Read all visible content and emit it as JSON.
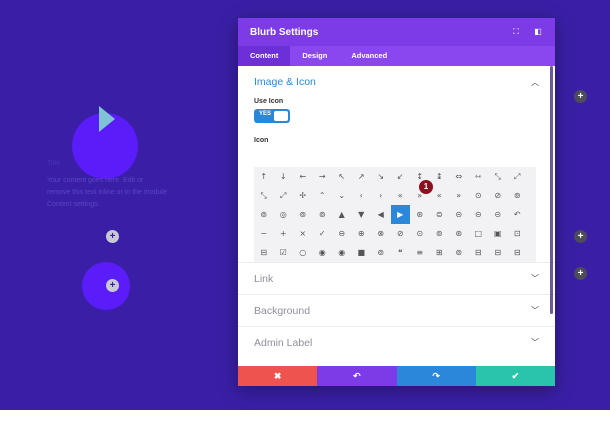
{
  "page": {
    "blurb_title": "Title",
    "blurb_text": "Your content goes here. Edit or remove this text inline or in the module Content settings."
  },
  "modal": {
    "title": "Blurb Settings",
    "header_icons": [
      "fullscreen-icon",
      "sidebar-toggle-icon"
    ],
    "tabs": [
      {
        "label": "Content",
        "active": true
      },
      {
        "label": "Design",
        "active": false
      },
      {
        "label": "Advanced",
        "active": false
      }
    ],
    "section_image_icon": {
      "title": "Image & Icon",
      "use_icon_label": "Use Icon",
      "toggle_value": "YES",
      "icon_label": "Icon",
      "icon_rows": [
        [
          "↑",
          "↓",
          "←",
          "→",
          "↖",
          "↗",
          "↘",
          "↙",
          "↕",
          "↨",
          "⇔",
          "⇿",
          "⤡",
          "⤢"
        ],
        [
          "⤡",
          "⤢",
          "✢",
          "⌃",
          "⌄",
          "‹",
          "›",
          "«",
          "»",
          "«",
          "»",
          "⊙",
          "⊘",
          "⊚"
        ],
        [
          "⊚",
          "◎",
          "⊚",
          "⊚",
          "▲",
          "▼",
          "◀",
          "▶",
          "⊛",
          "⊜",
          "⊝",
          "⊝",
          "⊝",
          "↶"
        ],
        [
          "−",
          "+",
          "×",
          "✓",
          "⊖",
          "⊕",
          "⊗",
          "⊘",
          "⊙",
          "⊚",
          "⊛",
          "□",
          "▣",
          "⊡"
        ],
        [
          "⊟",
          "☑",
          "○",
          "◉",
          "◉",
          "■",
          "⊚",
          "❝",
          "≡",
          "⊞",
          "⊚",
          "⊟",
          "⊟",
          "⊟"
        ]
      ],
      "selected_icon": "▶",
      "badge": "1"
    },
    "collapsed_sections": [
      "Link",
      "Background",
      "Admin Label"
    ],
    "footer": {
      "cancel": "✖",
      "undo": "↶",
      "redo": "↷",
      "save": "✔"
    }
  },
  "colors": {
    "background": "#3a1fa6",
    "modal_header": "#7d3be8",
    "accent_blue": "#2b87da",
    "cancel": "#ef5350",
    "save": "#29c4a9",
    "badge": "#8b0f1e"
  }
}
